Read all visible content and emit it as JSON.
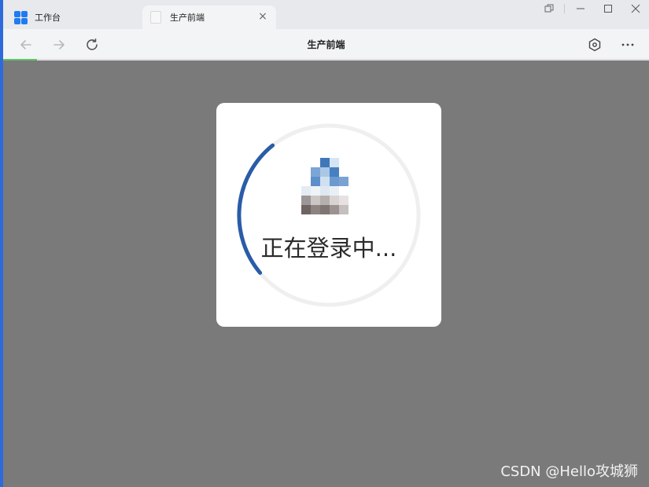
{
  "tabs": [
    {
      "label": "工作台",
      "icon": "grid-app-icon"
    },
    {
      "label": "生产前端",
      "icon": "page-icon",
      "close": "×"
    }
  ],
  "window_controls": [
    "restore-alt-icon",
    "minimize-icon",
    "maximize-icon",
    "close-icon"
  ],
  "toolbar": {
    "title": "生产前端",
    "back": "back-arrow-icon",
    "forward": "forward-arrow-icon",
    "reload": "reload-icon",
    "settings": "hexagon-settings-icon",
    "more": "more-icon"
  },
  "login": {
    "text": "正在登录中..."
  },
  "watermark": "CSDN @Hello攻城狮",
  "colors": {
    "accent": "#1f7bf2",
    "spinner": "#2a5ca8",
    "overlay": "#7a7a7a",
    "load_bar": "#5bc76a"
  }
}
